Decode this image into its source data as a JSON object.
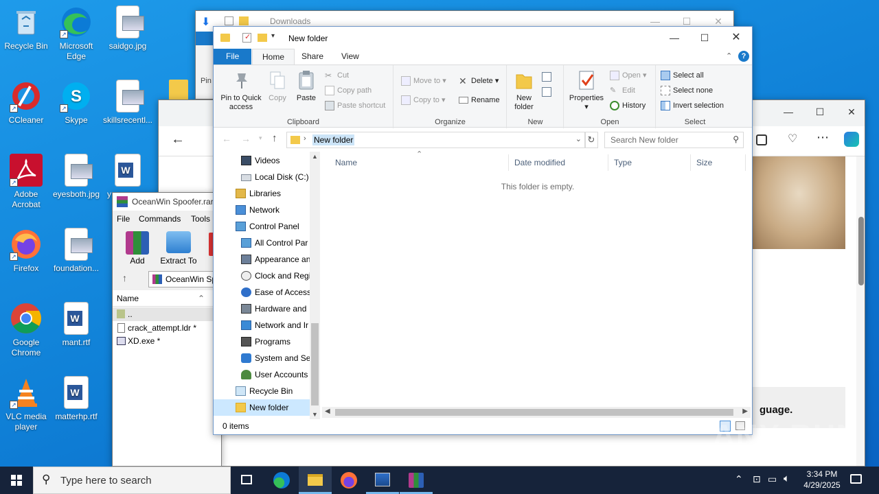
{
  "desktop": {
    "icons": [
      {
        "label": "Recycle Bin"
      },
      {
        "label": "Microsoft Edge"
      },
      {
        "label": "saidgo.jpg"
      },
      {
        "label": "CCleaner"
      },
      {
        "label": "Skype"
      },
      {
        "label": "skillsrecentl..."
      },
      {
        "label": "Adobe Acrobat"
      },
      {
        "label": "eyesboth.jpg"
      },
      {
        "label": "y"
      },
      {
        "label": "Firefox"
      },
      {
        "label": "foundation..."
      },
      {
        "label": "Google Chrome"
      },
      {
        "label": "mant.rtf"
      },
      {
        "label": "VLC media player"
      },
      {
        "label": "matterhp.rtf"
      }
    ]
  },
  "downloads_window": {
    "title": "Downloads",
    "partial_text": "Pin"
  },
  "browser_window": {
    "partial_text": "guage."
  },
  "winrar": {
    "title": "OceanWin Spoofer.rar",
    "menu": [
      "File",
      "Commands",
      "Tools"
    ],
    "toolbar": [
      "Add",
      "Extract To"
    ],
    "path": "OceanWin Sp",
    "col_name": "Name",
    "files": [
      "..",
      "crack_attempt.ldr *",
      "XD.exe *"
    ]
  },
  "explorer": {
    "title": "New folder",
    "tabs": [
      "File",
      "Home",
      "Share",
      "View"
    ],
    "clipboard": {
      "pin": "Pin to Quick access",
      "copy": "Copy",
      "paste": "Paste",
      "cut": "Cut",
      "copy_path": "Copy path",
      "paste_shortcut": "Paste shortcut",
      "group": "Clipboard"
    },
    "organize": {
      "move_to": "Move to",
      "delete": "Delete",
      "copy_to": "Copy to",
      "rename": "Rename",
      "group": "Organize"
    },
    "new": {
      "new_folder": "New folder",
      "group": "New"
    },
    "open": {
      "properties": "Properties",
      "open": "Open",
      "edit": "Edit",
      "history": "History",
      "group": "Open"
    },
    "select": {
      "select_all": "Select all",
      "select_none": "Select none",
      "invert": "Invert selection",
      "group": "Select"
    },
    "address": {
      "path": "New folder",
      "search_placeholder": "Search New folder"
    },
    "nav": [
      "Videos",
      "Local Disk (C:)",
      "Libraries",
      "Network",
      "Control Panel",
      "All Control Par",
      "Appearance an",
      "Clock and Regi",
      "Ease of Access",
      "Hardware and",
      "Network and Ir",
      "Programs",
      "System and Se",
      "User Accounts",
      "Recycle Bin",
      "New folder"
    ],
    "columns": [
      "Name",
      "Date modified",
      "Type",
      "Size"
    ],
    "empty_text": "This folder is empty.",
    "status": "0 items"
  },
  "taskbar": {
    "search_placeholder": "Type here to search",
    "time": "3:34 PM",
    "date": "4/29/2025"
  },
  "watermark": "ANY RUN"
}
